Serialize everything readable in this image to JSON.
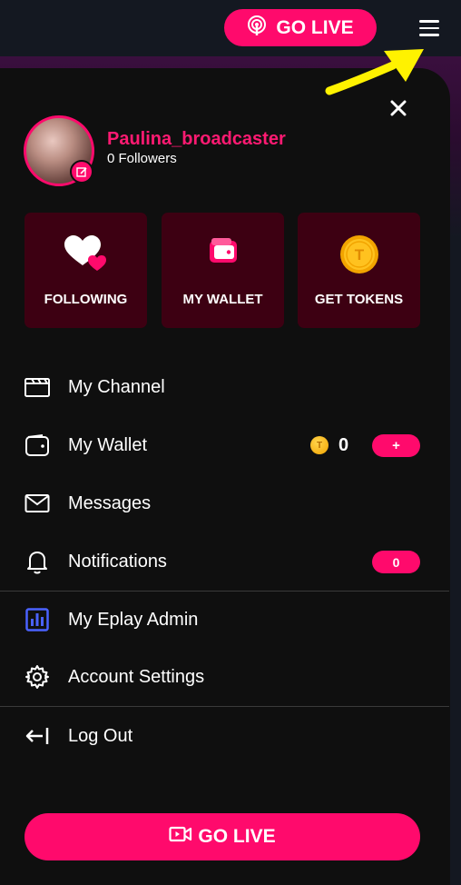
{
  "header": {
    "go_live_label": "GO LIVE"
  },
  "profile": {
    "username": "Paulina_broadcaster",
    "followers": "0 Followers"
  },
  "tiles": [
    {
      "label": "FOLLOWING",
      "icon": "hearts-icon"
    },
    {
      "label": "MY WALLET",
      "icon": "wallet-icon"
    },
    {
      "label": "GET TOKENS",
      "icon": "token-coin-icon"
    }
  ],
  "menu": {
    "my_channel": "My Channel",
    "my_wallet": "My Wallet",
    "wallet_balance": "0",
    "wallet_add": "+",
    "messages": "Messages",
    "notifications": "Notifications",
    "notifications_count": "0",
    "admin": "My Eplay Admin",
    "account_settings": "Account Settings",
    "log_out": "Log Out"
  },
  "footer": {
    "go_live_label": "GO LIVE"
  },
  "colors": {
    "accent": "#ff0a6c",
    "tile_bg": "#3d0012",
    "drawer_bg": "#0f0f0f",
    "admin_icon": "#4a62ff",
    "coin": "#f5b400",
    "annotation_arrow": "#fff200"
  }
}
